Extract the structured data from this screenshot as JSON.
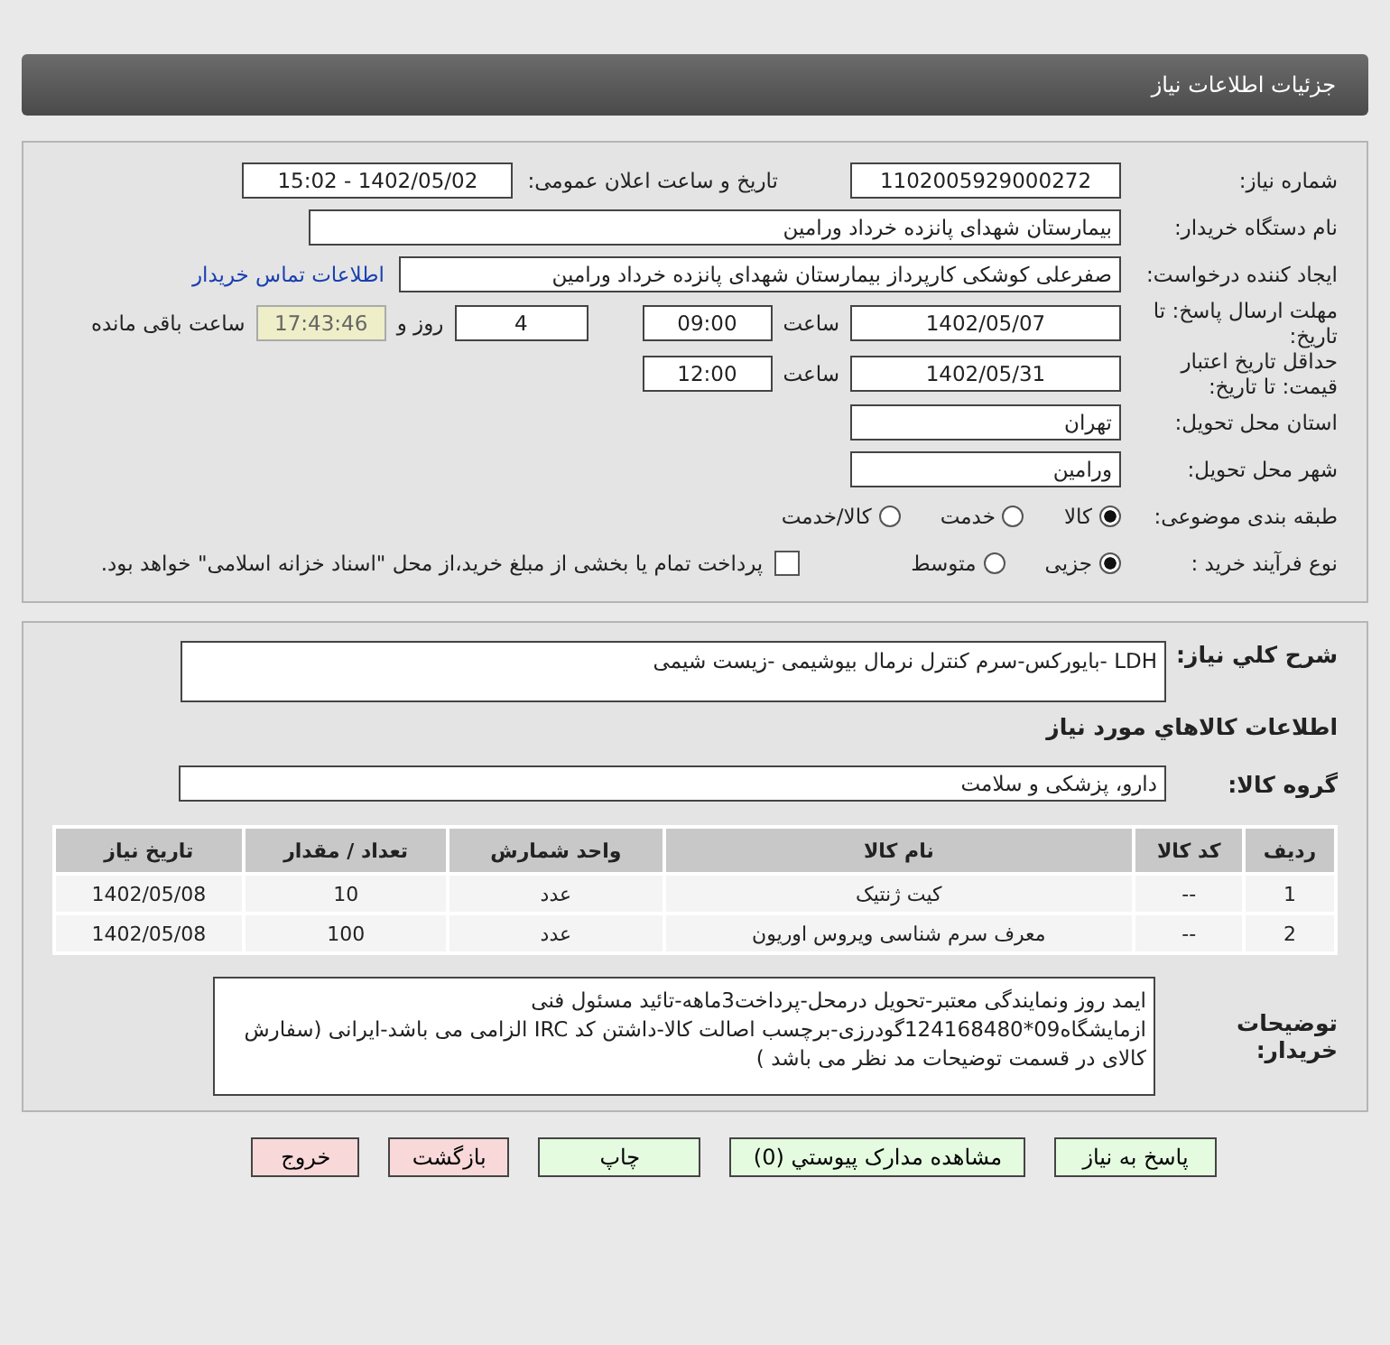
{
  "header": {
    "title": "جزئیات اطلاعات نیاز"
  },
  "need_number": {
    "label": "شماره نیاز:",
    "value": "1102005929000272"
  },
  "announce": {
    "label": "تاریخ و ساعت اعلان عمومی:",
    "value": "1402/05/02 - 15:02"
  },
  "buyer_org": {
    "label": "نام دستگاه خریدار:",
    "value": "بیمارستان شهدای پانزده خرداد ورامین"
  },
  "requester": {
    "label": "ایجاد کننده درخواست:",
    "value": "صفرعلی کوشکی کارپرداز بیمارستان شهدای پانزده خرداد ورامین",
    "link": "اطلاعات تماس خریدار"
  },
  "deadline": {
    "label": "مهلت ارسال پاسخ: تا تاریخ:",
    "date": "1402/05/07",
    "time_label": "ساعت",
    "time": "09:00",
    "days": "4",
    "days_label": "روز و",
    "remaining": "17:43:46",
    "remaining_label": "ساعت باقی مانده"
  },
  "validity": {
    "label": "حداقل تاریخ اعتبار قیمت: تا تاریخ:",
    "date": "1402/05/31",
    "time_label": "ساعت",
    "time": "12:00"
  },
  "province": {
    "label": "استان محل تحویل:",
    "value": "تهران"
  },
  "city": {
    "label": "شهر محل تحویل:",
    "value": "ورامین"
  },
  "category": {
    "label": "طبقه بندی موضوعی:",
    "options": [
      {
        "label": "کالا",
        "selected": true
      },
      {
        "label": "خدمت",
        "selected": false
      },
      {
        "label": "کالا/خدمت",
        "selected": false
      }
    ]
  },
  "purchase_type": {
    "label": "نوع فرآیند خرید :",
    "options": [
      {
        "label": "جزیی",
        "selected": true
      },
      {
        "label": "متوسط",
        "selected": false
      }
    ],
    "treasury": {
      "checked": false,
      "text": "پرداخت تمام یا بخشی از مبلغ خرید،از محل \"اسناد خزانه اسلامی\" خواهد بود."
    }
  },
  "summary": {
    "label": "شرح كلي نياز:",
    "value": "LDH -بایورکس-سرم کنترل نرمال بیوشیمی -زیست شیمی"
  },
  "goods_title": "اطلاعات كالاهاي مورد نياز",
  "group": {
    "label": "گروه کالا:",
    "value": "دارو، پزشکی و سلامت"
  },
  "table": {
    "columns": [
      "ردیف",
      "کد کالا",
      "نام کالا",
      "واحد شمارش",
      "تعداد / مقدار",
      "تاریخ نیاز"
    ],
    "rows": [
      [
        "1",
        "--",
        "کیت ژنتیک",
        "عدد",
        "10",
        "1402/05/08"
      ],
      [
        "2",
        "--",
        "معرف سرم شناسی ویروس اوریون",
        "عدد",
        "100",
        "1402/05/08"
      ]
    ]
  },
  "buyer_notes": {
    "label": "توضیحات خریدار:",
    "value": "ایمد روز ونمایندگی معتبر-تحویل درمحل-پرداخت3ماهه-تائید مسئول فنی ازمایشگاه09*124168480گودرزی-برچسب اصالت کالا-داشتن کد IRC الزامی می باشد-ایرانی (سفارش کالای در قسمت توضیحات مد نظر می باشد )"
  },
  "buttons": [
    {
      "label": "پاسخ به نیاز",
      "kind": "green"
    },
    {
      "label": "مشاهده مدارک پیوستي (0)",
      "kind": "green"
    },
    {
      "label": "چاپ",
      "kind": "green"
    },
    {
      "label": "بازگشت",
      "kind": "red"
    },
    {
      "label": "خروج",
      "kind": "red"
    }
  ]
}
